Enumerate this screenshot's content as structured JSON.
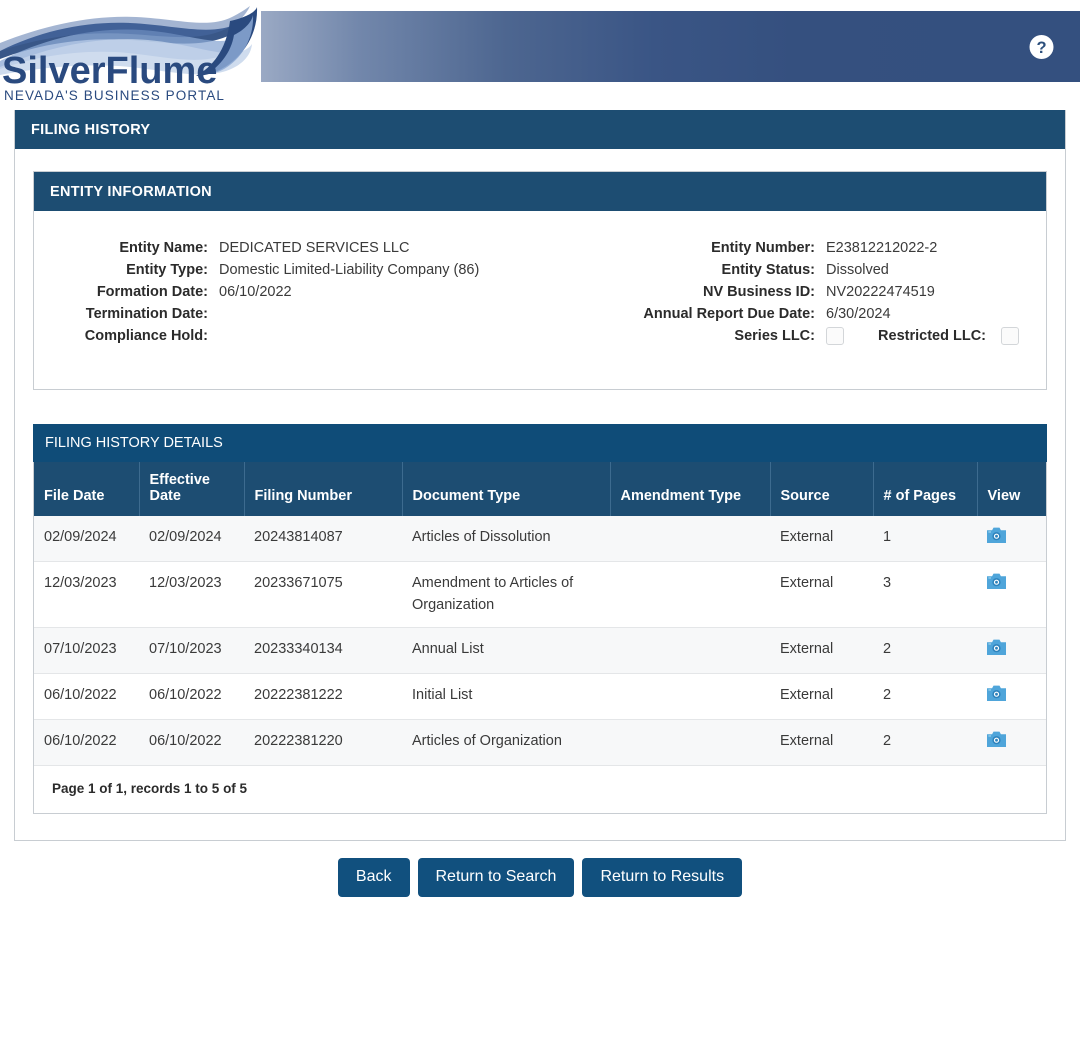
{
  "header": {
    "logo_title": "SilverFlume",
    "logo_subtitle": "NEVADA'S BUSINESS PORTAL",
    "help_icon": "question-mark-circle-icon",
    "bar_color_start": "#9aa9c4",
    "bar_color_end": "#34507f"
  },
  "filing_history": {
    "title": "FILING HISTORY"
  },
  "entity_information": {
    "title": "ENTITY INFORMATION",
    "fields": {
      "entity_name_label": "Entity Name:",
      "entity_name_value": "DEDICATED SERVICES LLC",
      "entity_number_label": "Entity Number:",
      "entity_number_value": "E23812212022-2",
      "entity_type_label": "Entity Type:",
      "entity_type_value": "Domestic Limited-Liability Company (86)",
      "entity_status_label": "Entity Status:",
      "entity_status_value": "Dissolved",
      "formation_date_label": "Formation Date:",
      "formation_date_value": "06/10/2022",
      "nv_business_id_label": "NV Business ID:",
      "nv_business_id_value": "NV20222474519",
      "termination_date_label": "Termination Date:",
      "termination_date_value": "",
      "annual_report_due_date_label": "Annual Report Due Date:",
      "annual_report_due_date_value": "6/30/2024",
      "compliance_hold_label": "Compliance Hold:",
      "compliance_hold_value": "",
      "series_llc_label": "Series LLC:",
      "series_llc_checked": false,
      "restricted_llc_label": "Restricted LLC:",
      "restricted_llc_checked": false
    }
  },
  "filing_history_details": {
    "title": "FILING HISTORY DETAILS",
    "columns": [
      "File Date",
      "Effective Date",
      "Filing Number",
      "Document Type",
      "Amendment Type",
      "Source",
      "# of Pages",
      "View"
    ],
    "rows": [
      {
        "file_date": "02/09/2024",
        "effective_date": "02/09/2024",
        "filing_number": "20243814087",
        "document_type": "Articles of Dissolution",
        "amendment_type": "",
        "source": "External",
        "pages": "1",
        "view_icon": "camera-icon"
      },
      {
        "file_date": "12/03/2023",
        "effective_date": "12/03/2023",
        "filing_number": "20233671075",
        "document_type": "Amendment to Articles of Organization",
        "amendment_type": "",
        "source": "External",
        "pages": "3",
        "view_icon": "camera-icon"
      },
      {
        "file_date": "07/10/2023",
        "effective_date": "07/10/2023",
        "filing_number": "20233340134",
        "document_type": "Annual List",
        "amendment_type": "",
        "source": "External",
        "pages": "2",
        "view_icon": "camera-icon"
      },
      {
        "file_date": "06/10/2022",
        "effective_date": "06/10/2022",
        "filing_number": "20222381222",
        "document_type": "Initial List",
        "amendment_type": "",
        "source": "External",
        "pages": "2",
        "view_icon": "camera-icon"
      },
      {
        "file_date": "06/10/2022",
        "effective_date": "06/10/2022",
        "filing_number": "20222381220",
        "document_type": "Articles of Organization",
        "amendment_type": "",
        "source": "External",
        "pages": "2",
        "view_icon": "camera-icon"
      }
    ],
    "pagination": "Page 1 of 1, records 1 to 5 of 5"
  },
  "footer": {
    "back_label": "Back",
    "return_to_search_label": "Return to Search",
    "return_to_results_label": "Return to Results",
    "button_color": "#11507e"
  }
}
